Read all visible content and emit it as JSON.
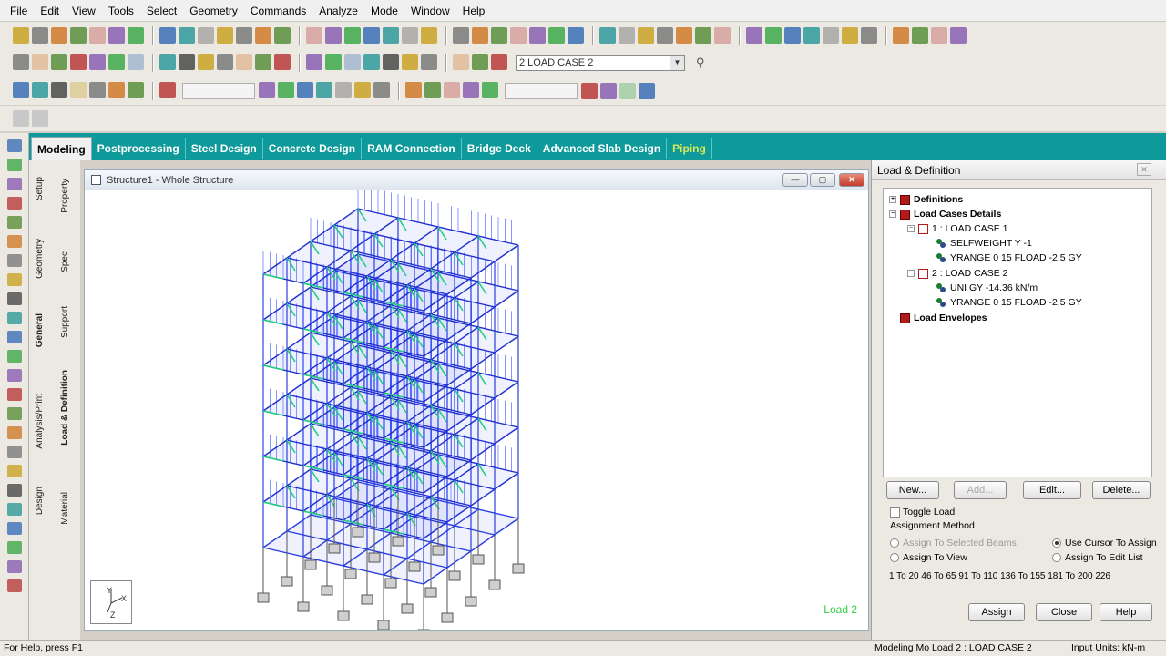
{
  "menu": [
    "File",
    "Edit",
    "View",
    "Tools",
    "Select",
    "Geometry",
    "Commands",
    "Analyze",
    "Mode",
    "Window",
    "Help"
  ],
  "toolbar": {
    "load_case_combo": "2 LOAD CASE 2"
  },
  "page_tabs": [
    {
      "label": "Modeling",
      "active": true
    },
    {
      "label": "Postprocessing"
    },
    {
      "label": "Steel Design"
    },
    {
      "label": "Concrete Design"
    },
    {
      "label": "RAM Connection"
    },
    {
      "label": "Bridge Deck"
    },
    {
      "label": "Advanced Slab Design"
    },
    {
      "label": "Piping",
      "disabled": true
    }
  ],
  "side_tabs_outer": [
    "Setup",
    "Geometry",
    "General",
    "Analysis/Print",
    "Design"
  ],
  "side_tabs_inner": [
    "Property",
    "Spec",
    "Support",
    "Load & Definition",
    "Material"
  ],
  "structure_window": {
    "title": "Structure1 - Whole Structure",
    "load_label": "Load 2",
    "axes": {
      "y": "Y",
      "x": "X",
      "z": "Z"
    }
  },
  "panel": {
    "title": "Load & Definition",
    "tree": {
      "definitions": "Definitions",
      "load_cases_details": "Load Cases Details",
      "case1": "1 : LOAD CASE 1",
      "case1_items": [
        "SELFWEIGHT Y -1",
        "YRANGE 0 15 FLOAD -2.5 GY"
      ],
      "case2": "2 : LOAD CASE 2",
      "case2_items": [
        "UNI GY -14.36 kN/m",
        "YRANGE 0 15 FLOAD -2.5 GY"
      ],
      "envelopes": "Load Envelopes"
    },
    "buttons": {
      "new": "New...",
      "add": "Add...",
      "edit": "Edit...",
      "delete": "Delete..."
    },
    "toggle_load": "Toggle Load",
    "assignment_method": "Assignment Method",
    "options": {
      "selected_beams": "Assign To Selected Beams",
      "view": "Assign To View",
      "cursor": "Use Cursor To Assign",
      "edit_list": "Assign To Edit List"
    },
    "assign_list": "1 To 20 46 To 65 91 To 110 136 To 155 181 To 200 226",
    "footer": {
      "assign": "Assign",
      "close": "Close",
      "help": "Help"
    }
  },
  "status": {
    "help": "For Help, press F1",
    "mode": "Modeling Mo Load 2 : LOAD CASE 2",
    "units": "Input Units:  kN-m"
  }
}
